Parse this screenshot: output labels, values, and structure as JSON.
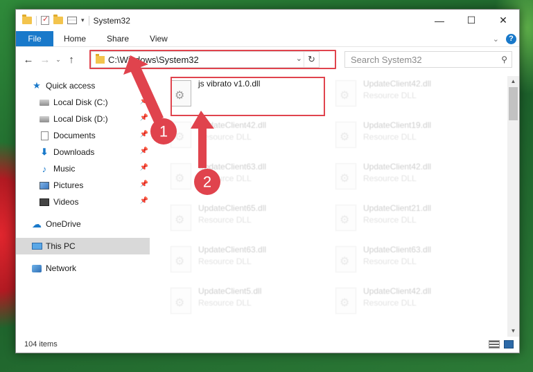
{
  "window": {
    "title": "System32",
    "controls": {
      "minimize": "—",
      "maximize": "☐",
      "close": "✕"
    }
  },
  "ribbon": {
    "tabs": [
      "File",
      "Home",
      "Share",
      "View"
    ],
    "help": "?"
  },
  "navigation": {
    "back_icon": "←",
    "forward_icon": "→",
    "recent_icon": "⌄",
    "up_icon": "↑",
    "address": "C:\\Windows\\System32",
    "search_placeholder": "Search System32"
  },
  "sidebar": {
    "items": [
      {
        "label": "Quick access",
        "icon": "star-icon",
        "pinned": false
      },
      {
        "label": "Local Disk (C:)",
        "icon": "disk-icon",
        "pinned": true
      },
      {
        "label": "Local Disk (D:)",
        "icon": "disk-icon",
        "pinned": true
      },
      {
        "label": "Documents",
        "icon": "documents-icon",
        "pinned": true
      },
      {
        "label": "Downloads",
        "icon": "download-icon",
        "pinned": true
      },
      {
        "label": "Music",
        "icon": "music-icon",
        "pinned": true
      },
      {
        "label": "Pictures",
        "icon": "pictures-icon",
        "pinned": true
      },
      {
        "label": "Videos",
        "icon": "videos-icon",
        "pinned": true
      },
      {
        "label": "OneDrive",
        "icon": "cloud-icon",
        "pinned": false
      },
      {
        "label": "This PC",
        "icon": "computer-icon",
        "pinned": false,
        "selected": true
      },
      {
        "label": "Network",
        "icon": "network-icon",
        "pinned": false
      }
    ]
  },
  "files": [
    {
      "name": "js vibrato v1.0.dll",
      "type": "",
      "highlighted": true
    },
    {
      "name": "UpdateClient42.dll",
      "type": "Resource DLL"
    },
    {
      "name": "UpdateClient42.dll",
      "type": "Resource DLL"
    },
    {
      "name": "UpdateClient19.dll",
      "type": "Resource DLL"
    },
    {
      "name": "UpdateClient63.dll",
      "type": "Resource DLL"
    },
    {
      "name": "UpdateClient42.dll",
      "type": "Resource DLL"
    },
    {
      "name": "UpdateClient65.dll",
      "type": "Resource DLL"
    },
    {
      "name": "UpdateClient21.dll",
      "type": "Resource DLL"
    },
    {
      "name": "UpdateClient63.dll",
      "type": "Resource DLL"
    },
    {
      "name": "UpdateClient63.dll",
      "type": "Resource DLL"
    },
    {
      "name": "UpdateClient5.dll",
      "type": "Resource DLL"
    },
    {
      "name": "UpdateClient42.dll",
      "type": "Resource DLL"
    }
  ],
  "status": {
    "item_count": "104 items"
  },
  "annotations": {
    "step1": "1",
    "step2": "2",
    "color": "#e0434d"
  }
}
